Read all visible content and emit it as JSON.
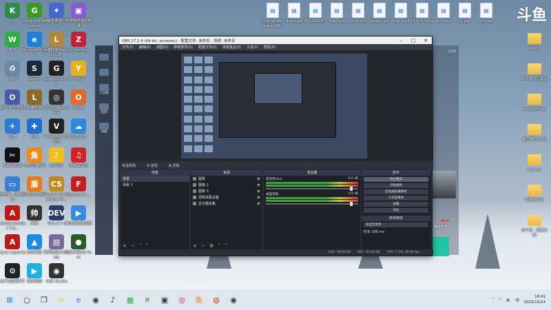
{
  "desktop": {
    "left_icons": [
      {
        "label": "KOOK",
        "glyph": "K",
        "color": "#2c8c4a"
      },
      {
        "label": "GeForce Experience",
        "glyph": "G",
        "color": "#3c9a24"
      },
      {
        "label": "电脑世界观光平台",
        "glyph": "✦",
        "color": "#4a68c8"
      },
      {
        "label": "哔哩哔哩视频图谱",
        "glyph": "▣",
        "color": "#8a5ad0"
      },
      {
        "label": "微信",
        "glyph": "W",
        "color": "#2aae3e"
      },
      {
        "label": "Microsoft Edge",
        "glyph": "e",
        "color": "#1f7fd6"
      },
      {
        "label": "英雄联盟WeGame版",
        "glyph": "L",
        "color": "#b08a3a"
      },
      {
        "label": "IL-Setting",
        "glyph": "Z",
        "color": "#c0223a"
      },
      {
        "label": "回收站",
        "glyph": "♻",
        "color": "#6a88a8"
      },
      {
        "label": "Steam",
        "glyph": "S",
        "color": "#1b2838"
      },
      {
        "label": "Logitech G HUB",
        "glyph": "G",
        "color": "#222222"
      },
      {
        "label": "YY语音",
        "glyph": "Y",
        "color": "#e6b21e"
      },
      {
        "label": "SCT(电子竞技)",
        "glyph": "✪",
        "color": "#4a5aa8"
      },
      {
        "label": "英雄联盟",
        "glyph": "L",
        "color": "#8a6a2a"
      },
      {
        "label": "LOURIS 10.14ane",
        "glyph": "◎",
        "color": "#333333"
      },
      {
        "label": "Origin",
        "glyph": "O",
        "color": "#e06a2a"
      },
      {
        "label": "迅雷",
        "glyph": "✈",
        "color": "#2a7ad6"
      },
      {
        "label": "幻化",
        "glyph": "✚",
        "color": "#1f6fd0"
      },
      {
        "label": "VeryKuai VK加速器",
        "glyph": "V",
        "color": "#222222"
      },
      {
        "label": "百度网盘",
        "glyph": "☁",
        "color": "#2a8ae0"
      },
      {
        "label": "剪映专业版",
        "glyph": "✂",
        "color": "#111111"
      },
      {
        "label": "斗鱼直播伴侣",
        "glyph": "鱼",
        "color": "#f08a1a"
      },
      {
        "label": "QQ音乐",
        "glyph": "♪",
        "color": "#f0c020"
      },
      {
        "label": "网易云音乐",
        "glyph": "♫",
        "color": "#d0242a"
      },
      {
        "label": "此电脑 - 快捷方式",
        "glyph": "▭",
        "color": "#3a80d0"
      },
      {
        "label": "火绒安全软件",
        "glyph": "盾",
        "color": "#e87a1a"
      },
      {
        "label": "Counter-Strike Global Of...",
        "glyph": "CS",
        "color": "#c08a20"
      },
      {
        "label": "RustyLake...",
        "glyph": "F",
        "color": "#c02020"
      },
      {
        "label": "Adobe Acrobat 7.0...",
        "glyph": "A",
        "color": "#c01818"
      },
      {
        "label": "象棋",
        "glyph": "帅",
        "color": "#333333"
      },
      {
        "label": "Dev-C++",
        "glyph": "DEV",
        "color": "#2a3a6a"
      },
      {
        "label": "腾讯视频加速器",
        "glyph": "▶",
        "color": "#3a8ae0"
      },
      {
        "label": "Apex Legends",
        "glyph": "A",
        "color": "#b81c1c"
      },
      {
        "label": "腾讯课堂",
        "glyph": "▲",
        "color": "#1f8ae0"
      },
      {
        "label": "暴风播放2002.zip",
        "glyph": "▤",
        "color": "#7a6a9a"
      },
      {
        "label": "真实业绩3D Pool",
        "glyph": "●",
        "color": "#2a5a2a"
      },
      {
        "label": "ESTS直播文件",
        "glyph": "⚙",
        "color": "#222222"
      },
      {
        "label": "腾讯视频",
        "glyph": "▶",
        "color": "#20b0e0"
      },
      {
        "label": "OBS Studio",
        "glyph": "◉",
        "color": "#333333"
      }
    ],
    "top_files": [
      {
        "label": "Counter-str... Global Off...",
        "kind": "file"
      },
      {
        "label": "diaoy.jpg",
        "kind": "file"
      },
      {
        "label": "20220918...",
        "kind": "file"
      },
      {
        "label": "mao.jpg",
        "kind": "file"
      },
      {
        "label": "zhqi.jpg",
        "kind": "file"
      },
      {
        "label": "gaigai.jpg",
        "kind": "file"
      },
      {
        "label": "kuai.mp4",
        "kind": "file"
      },
      {
        "label": "DOUYU.png",
        "kind": "file"
      },
      {
        "label": "wd.mp4",
        "kind": "file"
      },
      {
        "label": "ly.jpg",
        "kind": "file"
      },
      {
        "label": "b2.jpg",
        "kind": "file"
      }
    ],
    "right_folders": [
      {
        "label": "ARD/"
      },
      {
        "label": "如梦亮相三体论"
      },
      {
        "label": "SettingFiles"
      },
      {
        "label": "暴力摩托2002"
      },
      {
        "label": "Archive"
      },
      {
        "label": "新建文件夹"
      },
      {
        "label": "两个位 · 精通大侠"
      }
    ],
    "logo": "斗鱼"
  },
  "obs": {
    "title": "OBS 27.2.4 (64-bit, windows) - 配置文件: 未命名 - 场景: 未命名",
    "menu": [
      "文件(F)",
      "编辑(E)",
      "视图(V)",
      "停靠部件(D)",
      "配置文件(P)",
      "场景集合(S)",
      "工具(T)",
      "帮助(H)"
    ],
    "no_source": "未选择源",
    "props_label": "属性",
    "filters_label": "滤镜",
    "docks": {
      "scenes": {
        "title": "场景",
        "items": [
          "场景",
          "场景 2"
        ]
      },
      "sources": {
        "title": "来源",
        "items": [
          "图像",
          "图像 2",
          "图像 3",
          "视频采集设备",
          "显示器采集"
        ]
      },
      "mixer": {
        "title": "混音器",
        "tracks": [
          {
            "name": "麦克风/Aux",
            "db": "0.0 dB"
          },
          {
            "name": "桌面音频",
            "db": "0.0 dB"
          }
        ]
      },
      "transitions": {
        "title": "转场特效",
        "type": "淡出至黑色",
        "duration_label": "时长",
        "duration": "300 ms"
      },
      "controls": {
        "title": "控件",
        "buttons": [
          "停止推流",
          "开始录制",
          "启动虚拟摄像机",
          "工作室模式",
          "设置",
          "退出"
        ]
      }
    },
    "status": {
      "live": "LIVE: 00:00:00",
      "rec": "REC: 00:00:00",
      "cpu": "CPU: 1.5%, 30.00 fps"
    }
  },
  "side_app": {
    "labels": [
      "工具箱",
      "视频",
      "收藏",
      "打开工具",
      "消息"
    ]
  },
  "right_panel": {
    "badge": "New",
    "caption": "推出打赏",
    "counter": "1/10"
  },
  "taskbar": {
    "icons": [
      "start-icon",
      "search-icon",
      "task-view-icon",
      "file-explorer-icon",
      "edge-icon",
      "steam-icon",
      "tiktok-icon",
      "game-icon",
      "xbox-icon",
      "terminal-icon",
      "netease-icon",
      "douyu-icon",
      "chrome-icon",
      "obs-icon"
    ],
    "clock_time": "19:41",
    "clock_date": "2022/10/24",
    "tray_lang": "中"
  }
}
